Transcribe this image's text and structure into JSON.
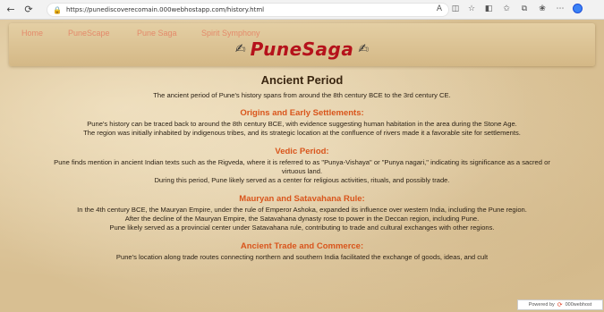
{
  "browser": {
    "url": "https://punediscoverecomain.000webhostapp.com/history.html",
    "icons": [
      "back-icon",
      "refresh-icon",
      "lock-icon",
      "read-aloud-icon",
      "split-screen-icon",
      "favorite-star-icon",
      "extensions-icon",
      "favorites-icon",
      "collections-icon",
      "copilot-icon",
      "more-icon",
      "profile-icon"
    ]
  },
  "nav": {
    "home": "Home",
    "punescape": "PuneScape",
    "punesaga": "Pune Saga",
    "spirit": "Spirit Symphony"
  },
  "brand": {
    "title": "PuneSaga"
  },
  "content": {
    "title": "Ancient Period",
    "intro": "The ancient period of Pune's history spans from around the 8th century BCE to the 3rd century CE.",
    "sections": [
      {
        "heading": "Origins and Early Settlements:",
        "lines": [
          "Pune's history can be traced back to around the 8th century BCE, with evidence suggesting human habitation in the area during the Stone Age.",
          "The region was initially inhabited by indigenous tribes, and its strategic location at the confluence of rivers made it a favorable site for settlements."
        ]
      },
      {
        "heading": "Vedic Period:",
        "lines": [
          "Pune finds mention in ancient Indian texts such as the Rigveda, where it is referred to as \"Punya-Vishaya\" or \"Punya nagari,\" indicating its significance as a sacred or",
          "virtuous land.",
          "During this period, Pune likely served as a center for religious activities, rituals, and possibly trade."
        ]
      },
      {
        "heading": "Mauryan and Satavahana Rule:",
        "lines": [
          "In the 4th century BCE, the Mauryan Empire, under the rule of Emperor Ashoka, expanded its influence over western India, including the Pune region.",
          "After the decline of the Mauryan Empire, the Satavahana dynasty rose to power in the Deccan region, including Pune.",
          "Pune likely served as a provincial center under Satavahana rule, contributing to trade and cultural exchanges with other regions."
        ]
      },
      {
        "heading": "Ancient Trade and Commerce:",
        "lines": [
          "Pune's location along trade routes connecting northern and southern India facilitated the exchange of goods, ideas, and cult"
        ]
      }
    ]
  },
  "powered": {
    "text": "Powered by",
    "brand": "000webhost"
  }
}
